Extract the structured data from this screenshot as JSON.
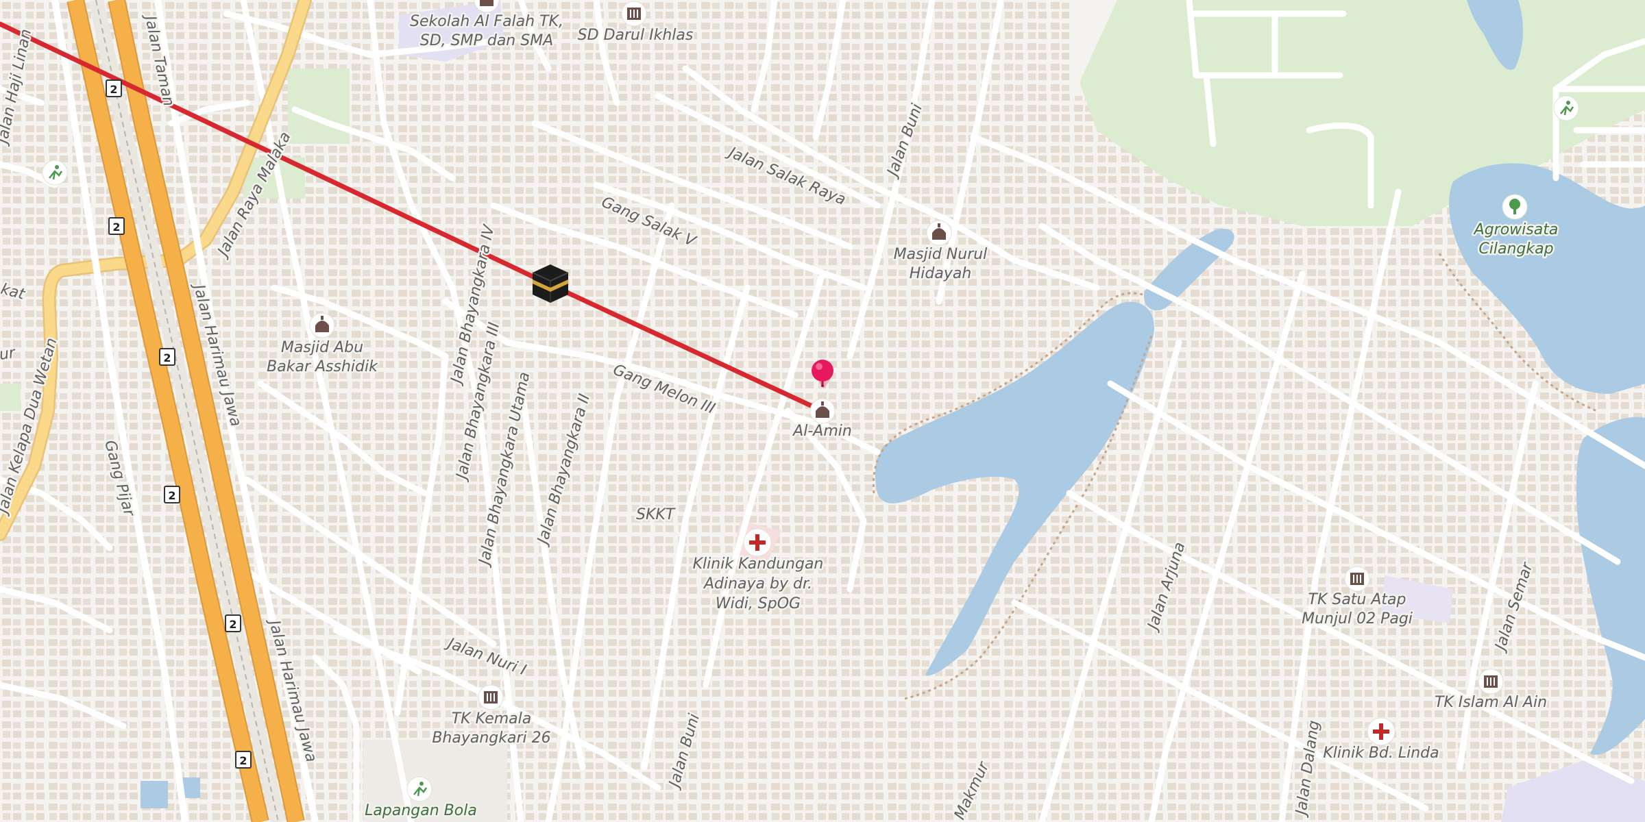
{
  "route": {
    "color": "#d8282f"
  },
  "streets": {
    "jalan_taman": "Jalan Taman",
    "jalan_haji_linan": "Jalan Haji Linan",
    "jalan_raya_malaka": "Jalan Raya Malaka",
    "jalan_harimau_jawa_1": "Jalan Harimau Jawa",
    "jalan_harimau_jawa_2": "Jalan Harimau Jawa",
    "jalan_kelapa_dua_wetan": "Jalan Kelapa Dua Wetan",
    "gang_pijar": "Gang Pijar",
    "jalan_bhayangkara_iv": "Jalan Bhayangkara IV",
    "jalan_bhayangkara_iii": "Jalan Bhayangkara III",
    "jalan_bhayangkara_utama": "Jalan Bhayangkara Utama",
    "jalan_bhayangkara_ii": "Jalan Bhayangkara II",
    "gang_melon_iii": "Gang Melon III",
    "gang_salak_v": "Gang Salak V",
    "jalan_salak_raya": "Jalan Salak Raya",
    "jalan_buni_1": "Jalan Buni",
    "jalan_buni_2": "Jalan Buni",
    "jalan_nuri_i": "Jalan Nuri I",
    "sktt": "SKKT",
    "jalan_arjuna": "Jalan Arjuna",
    "jalan_semar": "Jalan Semar",
    "jalan_dalang": "Jalan Dalang",
    "makmur": "Makmur",
    "kat": "kat",
    "ur": "ur"
  },
  "pois": {
    "sekolah_al_falah": [
      "Sekolah Al Falah TK,",
      "SD, SMP dan SMA"
    ],
    "sd_darul_ikhlas": [
      "SD Darul Ikhlas"
    ],
    "masjid_nurul_hidayah": [
      "Masjid Nurul",
      "Hidayah"
    ],
    "masjid_abu_bakar": [
      "Masjid Abu",
      "Bakar Asshidik"
    ],
    "al_amin": [
      "Al-Amin"
    ],
    "klinik_kandungan": [
      "Klinik Kandungan",
      "Adinaya by dr.",
      "Widi, SpOG"
    ],
    "tk_kemala": [
      "TK Kemala",
      "Bhayangkari 26"
    ],
    "lapangan_bola": [
      "Lapangan Bola"
    ],
    "agrowisata": [
      "Agrowisata",
      "Cilangkap"
    ],
    "tk_satu_atap": [
      "TK Satu Atap",
      "Munjul 02 Pagi"
    ],
    "tk_islam_al_ain": [
      "TK Islam Al Ain"
    ],
    "klinik_bd_linda": [
      "Klinik Bd. Linda"
    ]
  },
  "road_shields": [
    "2",
    "2",
    "2",
    "2",
    "2",
    "2"
  ],
  "icons": {
    "kaaba": "kaaba-icon",
    "pin": "location-pin-icon",
    "mosque": "mosque-icon",
    "school": "school-icon",
    "clinic": "clinic-icon",
    "sports": "sports-icon",
    "park": "tree-icon"
  },
  "colors": {
    "land": "#f5f3ef",
    "water": "#aacbe3",
    "park": "#dcecd0",
    "motorway": "#f5b04a",
    "primary": "#fbd98b",
    "pin": "#e8185f"
  }
}
